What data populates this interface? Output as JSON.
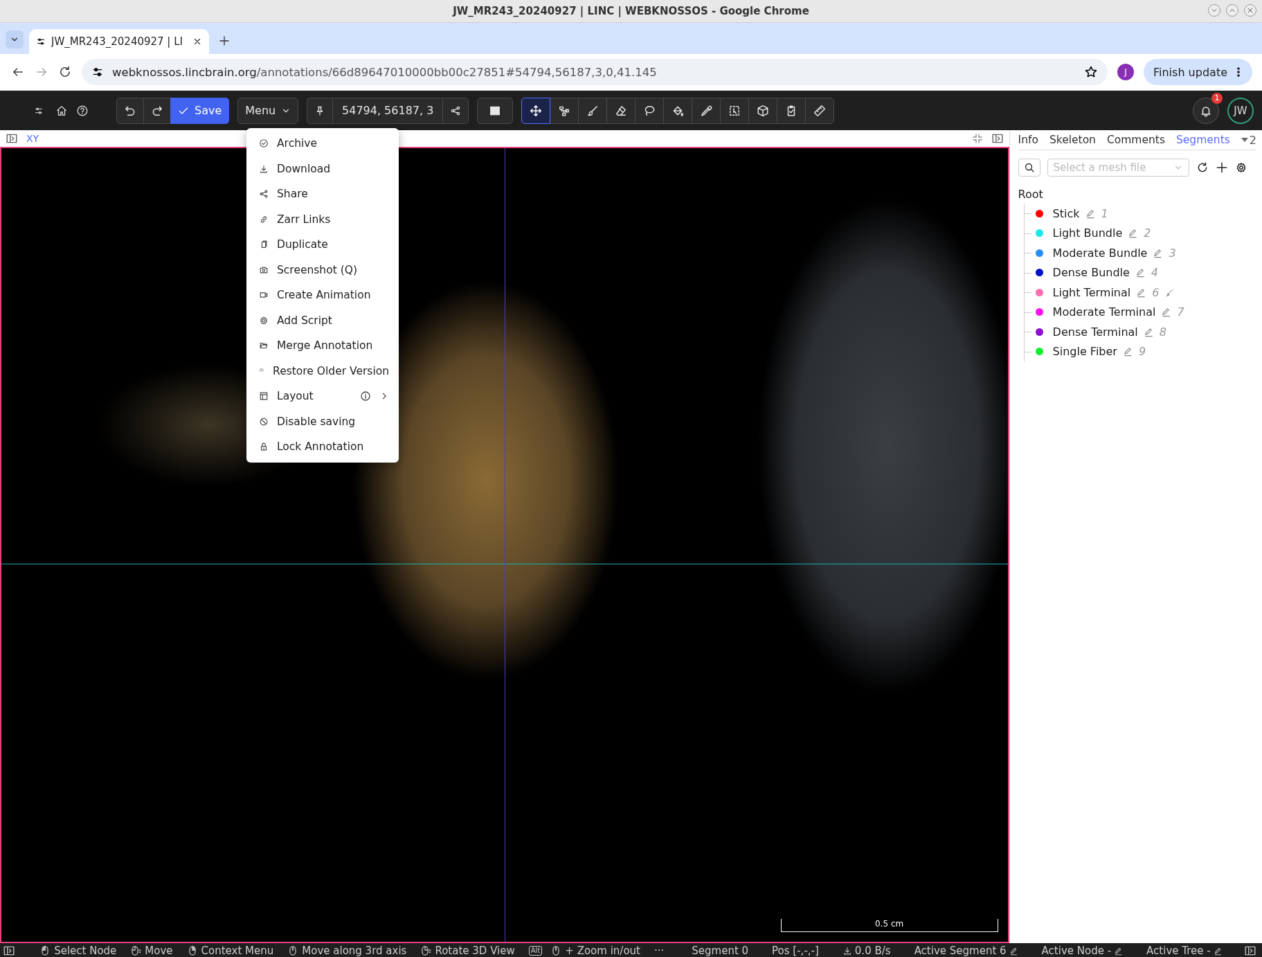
{
  "window": {
    "title": "JW_MR243_20240927 | LINC | WEBKNOSSOS - Google Chrome"
  },
  "browser": {
    "tab_title": "JW_MR243_20240927 | LI",
    "url_host": "webknossos.lincbrain.org",
    "url_path": "/annotations/66d89647010000bb00c27851#54794,56187,3,0,41.145",
    "profile": "J",
    "update_button": "Finish update"
  },
  "toolbar": {
    "save": "Save",
    "menu": "Menu",
    "position": "54794, 56187, 3",
    "tools": [
      {
        "kind": "move",
        "selected": true
      },
      {
        "kind": "skeleton",
        "selected": false
      },
      {
        "kind": "brush",
        "selected": false
      },
      {
        "kind": "eraser",
        "selected": false
      },
      {
        "kind": "lasso",
        "selected": false
      },
      {
        "kind": "fill",
        "selected": false
      },
      {
        "kind": "picker",
        "selected": false
      },
      {
        "kind": "quick-select",
        "selected": false
      },
      {
        "kind": "bounding-box",
        "selected": false
      },
      {
        "kind": "proofread",
        "selected": false
      },
      {
        "kind": "measure",
        "selected": false
      }
    ],
    "notifications": "1",
    "user": "JW"
  },
  "viewport": {
    "label": "XY",
    "scale_bar": "0.5 cm"
  },
  "menu": {
    "items": [
      {
        "label": "Archive",
        "submenu": false
      },
      {
        "label": "Download",
        "submenu": false
      },
      {
        "label": "Share",
        "submenu": false
      },
      {
        "label": "Zarr Links",
        "submenu": false
      },
      {
        "label": "Duplicate",
        "submenu": false
      },
      {
        "label": "Screenshot (Q)",
        "submenu": false
      },
      {
        "label": "Create Animation",
        "submenu": false
      },
      {
        "label": "Add Script",
        "submenu": false
      },
      {
        "label": "Merge Annotation",
        "submenu": false
      },
      {
        "label": "Restore Older Version",
        "submenu": false
      },
      {
        "label": "Layout",
        "submenu": true
      },
      {
        "label": "Disable saving",
        "submenu": false
      },
      {
        "label": "Lock Annotation",
        "submenu": false
      }
    ]
  },
  "panel": {
    "tabs": [
      {
        "label": "Info",
        "selected": false
      },
      {
        "label": "Skeleton",
        "selected": false
      },
      {
        "label": "Comments",
        "selected": false
      },
      {
        "label": "Segments",
        "selected": true
      }
    ],
    "more_count": "2",
    "mesh_select": {
      "placeholder": "Select a mesh file"
    },
    "tree": {
      "label": "Root",
      "children": [
        {
          "name": "Stick",
          "id": "1",
          "color": "#ff0000",
          "active": false
        },
        {
          "name": "Light Bundle",
          "id": "2",
          "color": "#1ae8e8",
          "active": false
        },
        {
          "name": "Moderate Bundle",
          "id": "3",
          "color": "#2a8cf5",
          "active": false
        },
        {
          "name": "Dense Bundle",
          "id": "4",
          "color": "#0010c8",
          "active": false
        },
        {
          "name": "Light Terminal",
          "id": "6",
          "color": "#ff6eb0",
          "active": true
        },
        {
          "name": "Moderate Terminal",
          "id": "7",
          "color": "#ff10e8",
          "active": false
        },
        {
          "name": "Dense Terminal",
          "id": "8",
          "color": "#9010d0",
          "active": false
        },
        {
          "name": "Single Fiber",
          "id": "9",
          "color": "#10f030",
          "active": false
        }
      ]
    }
  },
  "status_bar": {
    "hints": [
      {
        "label": "Select Node"
      },
      {
        "label": "Move"
      },
      {
        "label": "Context Menu"
      },
      {
        "label": "Move along 3rd axis"
      },
      {
        "label": "Rotate 3D View"
      },
      {
        "key": "Alt",
        "label": "+ Zoom in/out"
      }
    ],
    "more": "···",
    "info": [
      {
        "kind": "text",
        "label": "Segment 0"
      },
      {
        "kind": "text",
        "label": "Pos [-,-,-]"
      },
      {
        "kind": "speed",
        "label": "0.0 B/s"
      },
      {
        "kind": "editable",
        "label": "Active Segment 6"
      },
      {
        "kind": "editable",
        "label": "Active Node -"
      },
      {
        "kind": "editable",
        "label": "Active Tree -"
      }
    ]
  }
}
